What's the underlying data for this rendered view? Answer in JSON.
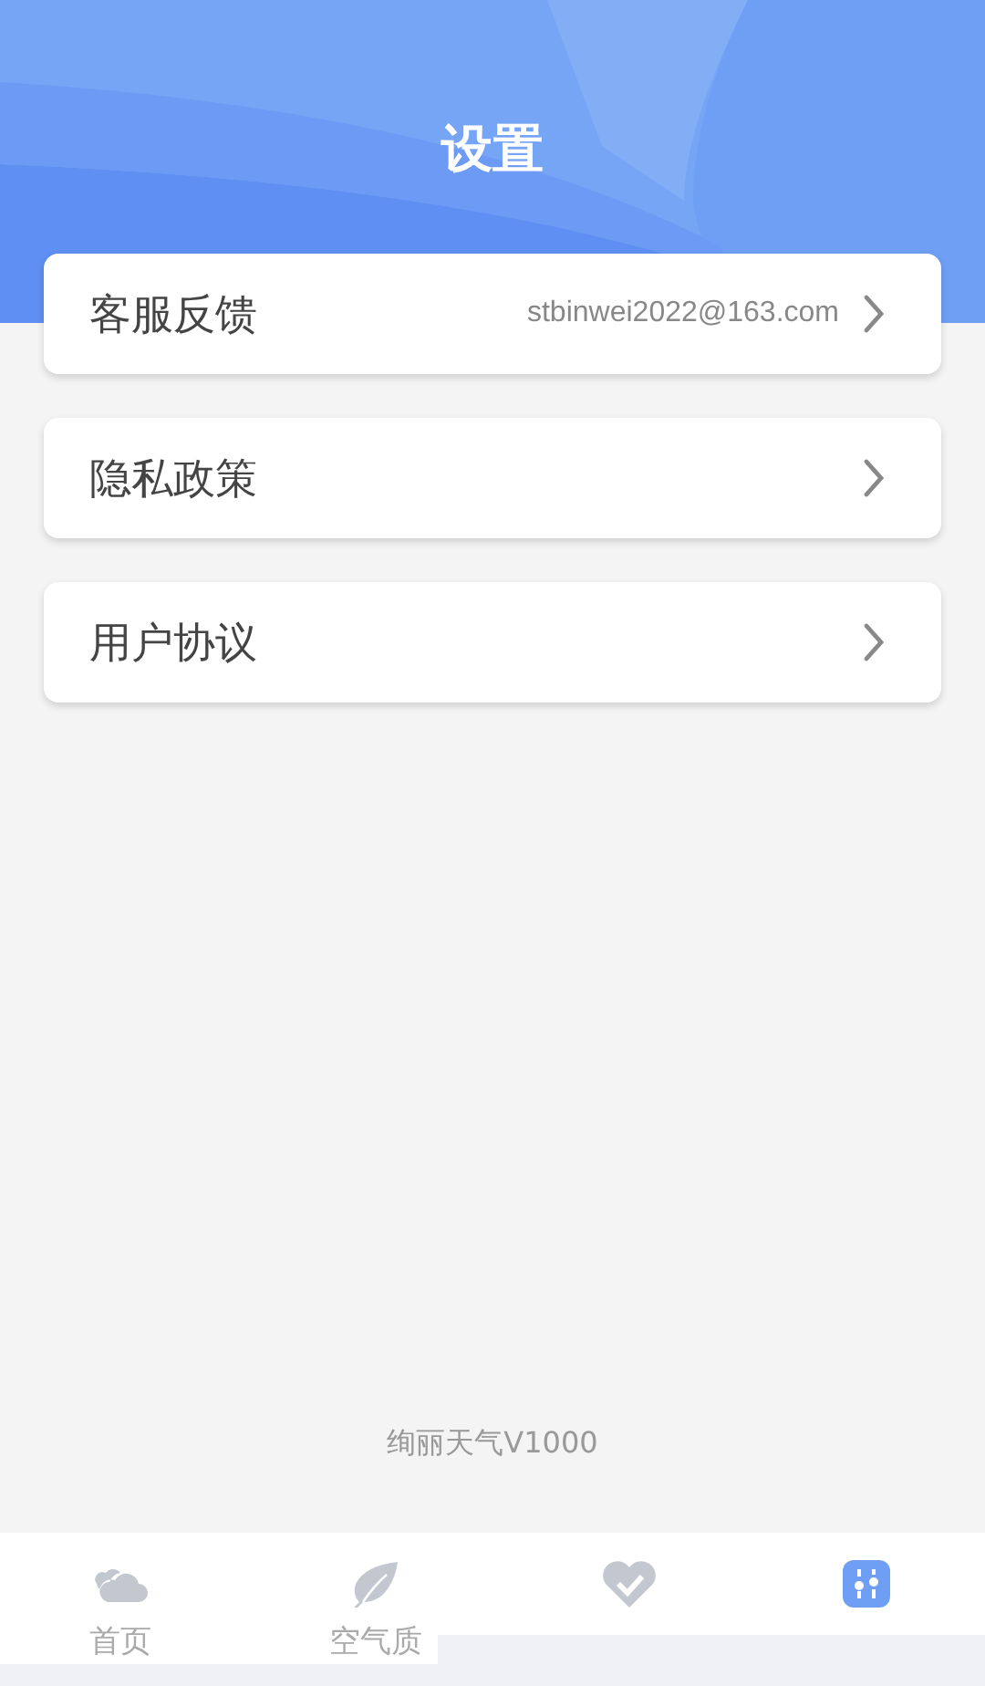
{
  "header": {
    "title": "设置"
  },
  "items": [
    {
      "label": "客服反馈",
      "value": "stbinwei2022@163.com"
    },
    {
      "label": "隐私政策"
    },
    {
      "label": "用户协议"
    }
  ],
  "version": "绚丽天气V1000",
  "tabs": [
    {
      "kind": "cloud",
      "label": "首页",
      "selected": false
    },
    {
      "kind": "leaf",
      "label": "空气质",
      "selected": false
    },
    {
      "kind": "heart",
      "selected": false
    },
    {
      "kind": "sliders",
      "selected": true
    }
  ]
}
